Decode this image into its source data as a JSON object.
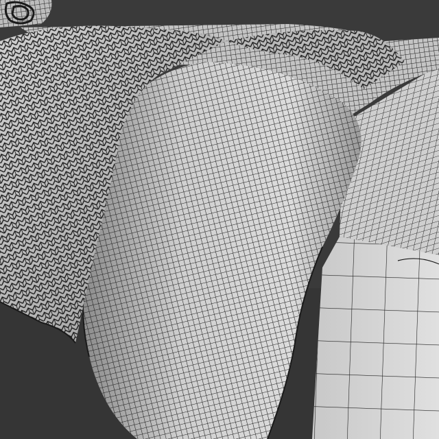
{
  "scene": {
    "subject": "bed-with-duvet-and-knit-throw",
    "render_mode": "wireframe",
    "colors": {
      "background": "#3a3a3a",
      "surface_light": "#d8d8d8",
      "surface_mid": "#a8a8a8",
      "surface_dark": "#5c5c5c",
      "wire": "#1a1a1a"
    }
  }
}
